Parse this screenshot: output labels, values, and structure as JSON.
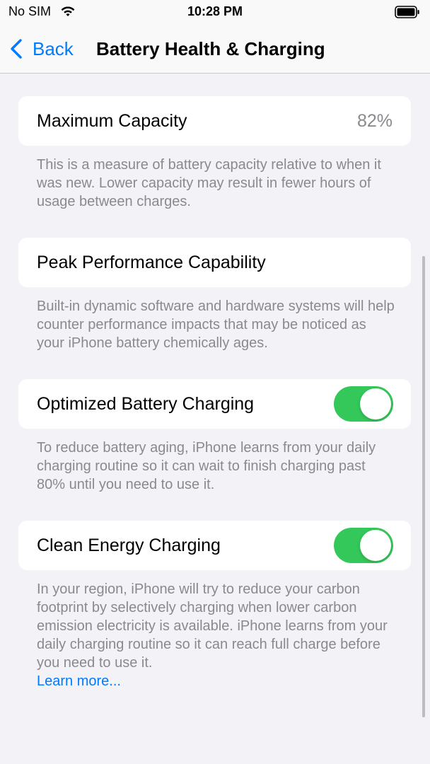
{
  "status_bar": {
    "carrier": "No SIM",
    "time": "10:28 PM",
    "icons": [
      "wifi-icon",
      "battery-icon"
    ]
  },
  "nav": {
    "back_label": "Back",
    "title": "Battery Health & Charging",
    "accent_color": "#007aff"
  },
  "sections": {
    "max_capacity": {
      "label": "Maximum Capacity",
      "value": "82%",
      "description": "This is a measure of battery capacity relative to when it was new. Lower capacity may result in fewer hours of usage between charges."
    },
    "peak_performance": {
      "label": "Peak Performance Capability",
      "description": "Built-in dynamic software and hardware systems will help counter performance impacts that may be noticed as your iPhone battery chemically ages."
    },
    "optimized_charging": {
      "label": "Optimized Battery Charging",
      "enabled": true,
      "description": "To reduce battery aging, iPhone learns from your daily charging routine so it can wait to finish charging past 80% until you need to use it."
    },
    "clean_energy": {
      "label": "Clean Energy Charging",
      "enabled": true,
      "description": "In your region, iPhone will try to reduce your carbon footprint by selectively charging when lower carbon emission electricity is available. iPhone learns from your daily charging routine so it can reach full charge before you need to use it.",
      "link_label": "Learn more..."
    }
  },
  "colors": {
    "toggle_on": "#34c759",
    "background": "#f2f2f7",
    "secondary_text": "#8a8a8e"
  }
}
